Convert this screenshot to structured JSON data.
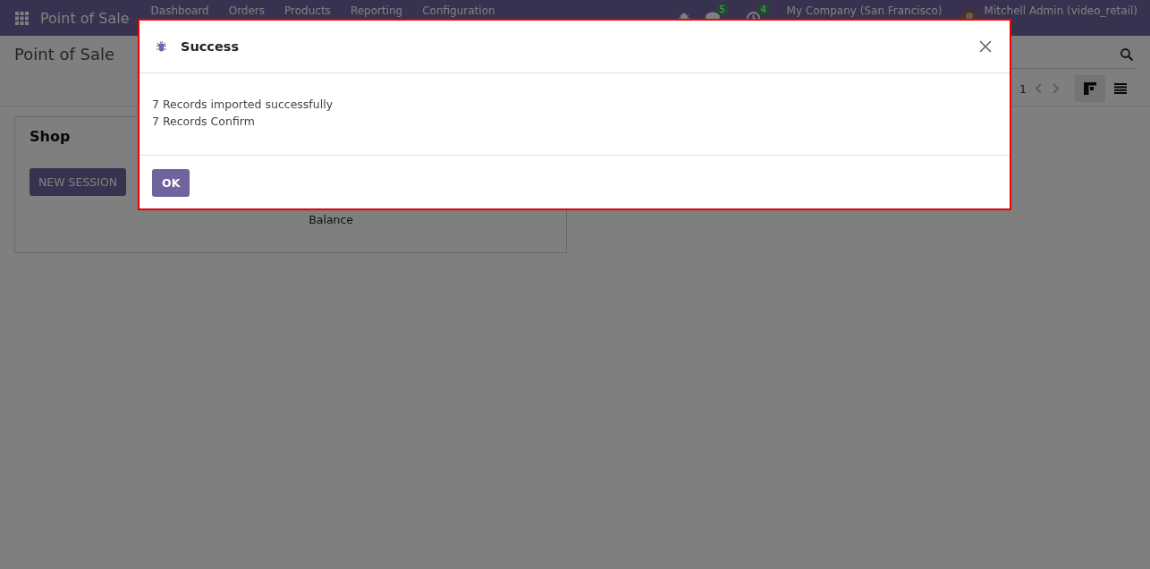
{
  "navbar": {
    "app_name": "Point of Sale",
    "menu": [
      "Dashboard",
      "Orders",
      "Products",
      "Reporting",
      "Configuration"
    ],
    "messages_badge": "5",
    "activities_badge": "4",
    "company": "My Company (San Francisco)",
    "user": "Mitchell Admin (video_retail)"
  },
  "control_panel": {
    "title": "Point of Sale",
    "pager": "1",
    "views": [
      {
        "kind": "kanban",
        "selected": true
      },
      {
        "kind": "list",
        "selected": false
      }
    ]
  },
  "cards": [
    {
      "name": "Shop",
      "button": "NEW SESSION",
      "label": "Balance"
    }
  ],
  "dialog": {
    "title": "Success",
    "messages": [
      "7 Records imported successfully",
      "7 Records Confirm"
    ],
    "buttons": [
      "OK"
    ]
  }
}
